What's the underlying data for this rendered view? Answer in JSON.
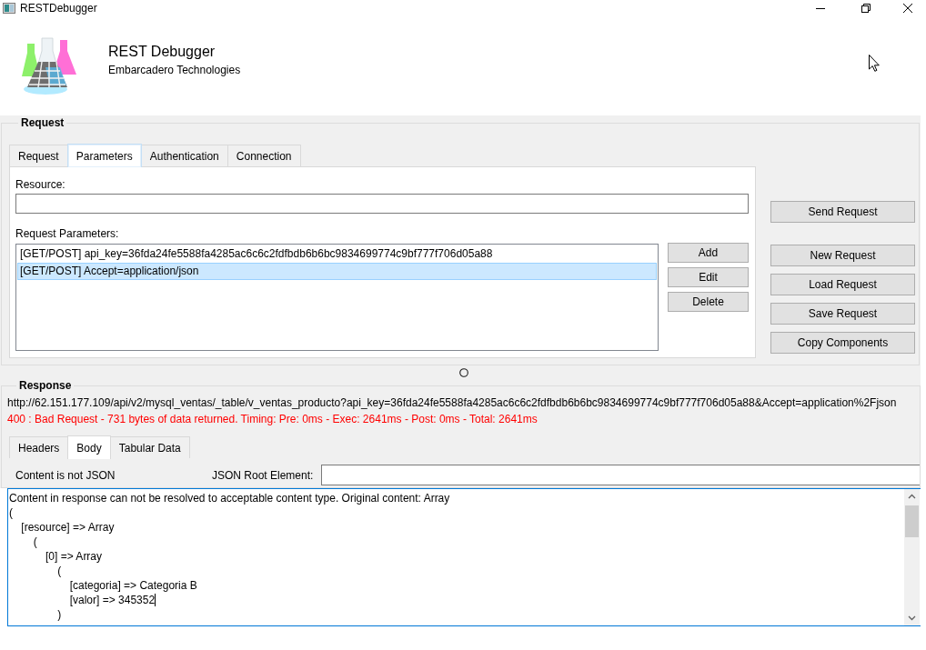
{
  "window": {
    "title": "RESTDebugger"
  },
  "header": {
    "title": "REST Debugger",
    "subtitle": "Embarcadero Technologies"
  },
  "request": {
    "legend": "Request",
    "tabs": [
      {
        "label": "Request",
        "selected": false
      },
      {
        "label": "Parameters",
        "selected": true
      },
      {
        "label": "Authentication",
        "selected": false
      },
      {
        "label": "Connection",
        "selected": false
      }
    ],
    "resource": {
      "label": "Resource:"
    },
    "parameters": {
      "label": "Request Parameters:",
      "items": [
        {
          "text": "[GET/POST] api_key=36fda24fe5588fa4285ac6c6c2fdfbdb6b6bc9834699774c9bf777f706d05a88",
          "selected": false
        },
        {
          "text": "[GET/POST] Accept=application/json",
          "selected": true
        }
      ],
      "buttons": [
        "Add",
        "Edit",
        "Delete"
      ]
    },
    "send_button": "Send Request",
    "action_buttons": [
      "New Request",
      "Load Request",
      "Save Request",
      "Copy Components"
    ]
  },
  "response": {
    "legend": "Response",
    "url": "http://62.151.177.109/api/v2/mysql_ventas/_table/v_ventas_producto?api_key=36fda24fe5588fa4285ac6c6c2fdfbdb6b6bc9834699774c9bf777f706d05a88&Accept=application%2Fjson",
    "status": "400 : Bad Request - 731 bytes of data returned. Timing: Pre: 0ms - Exec: 2641ms - Post: 0ms - Total: 2641ms",
    "error": true,
    "tabs": [
      {
        "label": "Headers",
        "selected": false
      },
      {
        "label": "Body",
        "selected": true
      },
      {
        "label": "Tabular Data",
        "selected": false
      }
    ],
    "content_note": "Content is not JSON",
    "root_element": {
      "label": "JSON Root Element:"
    },
    "body_lines": [
      {
        "text": "Content in response can not be resolved to acceptable content type. Original content: Array",
        "caret": false
      },
      {
        "text": "(",
        "caret": false
      },
      {
        "text": "    [resource] => Array",
        "caret": false
      },
      {
        "text": "        (",
        "caret": false
      },
      {
        "text": "            [0] => Array",
        "caret": false
      },
      {
        "text": "                (",
        "caret": false
      },
      {
        "text": "                    [categoria] => Categoria B",
        "caret": false
      },
      {
        "text": "                    [valor] => 345352",
        "caret": true
      },
      {
        "text": "                )",
        "caret": false
      }
    ]
  }
}
